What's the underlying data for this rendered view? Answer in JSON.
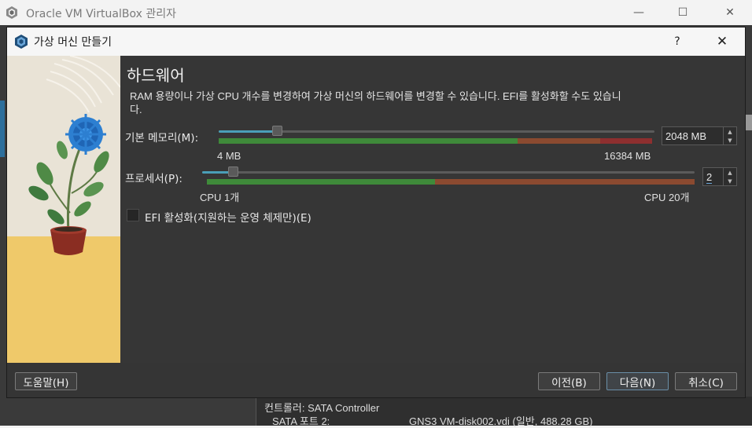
{
  "main_window": {
    "title": "Oracle VM VirtualBox 관리자",
    "minimize": "—",
    "maximize": "☐",
    "close": "✕"
  },
  "background_details": {
    "controller_line": "컨트롤러: SATA Controller",
    "port_label": "SATA 포트 2:",
    "port_value": "GNS3 VM-disk002.vdi (일반, 488.28 GB)"
  },
  "dialog": {
    "title": "가상 머신 만들기",
    "help": "?",
    "close": "✕",
    "page_title": "하드웨어",
    "description": "RAM 용량이나 가상 CPU 개수를 변경하여 가상 머신의 하드웨어를 변경할 수 있습니다. EFI를 활성화할 수도 있습니다.",
    "memory": {
      "label": "기본 메모리(M):",
      "value": "2048 MB",
      "min_label": "4 MB",
      "max_label": "16384 MB",
      "min": 4,
      "max": 16384,
      "current": 2048
    },
    "processor": {
      "label": "프로세서(P):",
      "value": "2",
      "min_label": "CPU 1개",
      "max_label": "CPU 20개",
      "min": 1,
      "max": 20,
      "current": 2
    },
    "efi_label": "EFI 활성화(지원하는 운영 체제만)(E)",
    "efi_checked": false,
    "buttons": {
      "help": "도움말(H)",
      "back": "이전(B)",
      "next": "다음(N)",
      "cancel": "취소(C)"
    }
  },
  "colors": {
    "accent": "#4a9fb8",
    "safe": "#3f8a3a",
    "warn": "#8b4a30",
    "danger": "#8e2f2f"
  }
}
